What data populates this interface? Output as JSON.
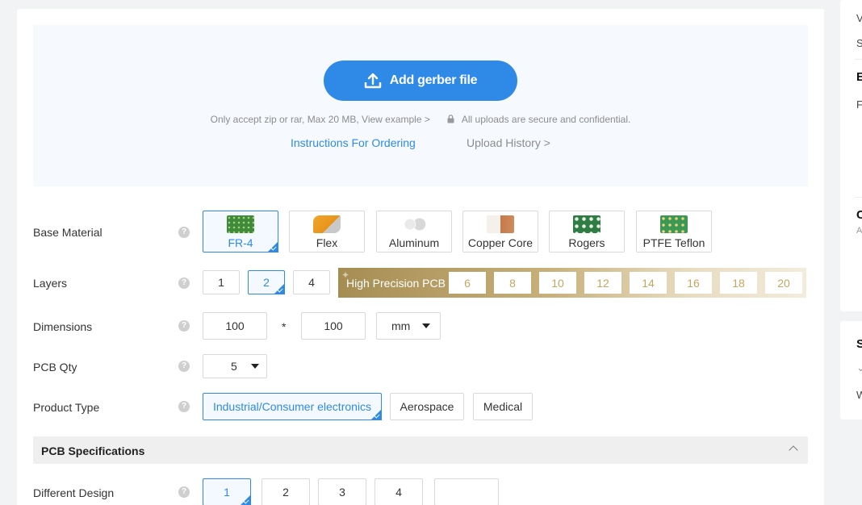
{
  "upload": {
    "button_label": "Add gerber file",
    "note": "Only accept zip or rar, Max 20 MB, View example >",
    "secure_note": "All uploads are secure and confidential.",
    "instructions_link": "Instructions For Ordering",
    "history_link": "Upload History >"
  },
  "base_material": {
    "label": "Base Material",
    "options": [
      "FR-4",
      "Flex",
      "Aluminum",
      "Copper Core",
      "Rogers",
      "PTFE Teflon"
    ],
    "selected": "FR-4"
  },
  "layers": {
    "label": "Layers",
    "options": [
      "1",
      "2",
      "4"
    ],
    "selected": "2",
    "high_precision_label": "High Precision PCB",
    "high_precision_options": [
      "6",
      "8",
      "10",
      "12",
      "14",
      "16",
      "18",
      "20"
    ]
  },
  "dimensions": {
    "label": "Dimensions",
    "width": "100",
    "separator": "*",
    "height": "100",
    "unit": "mm"
  },
  "pcb_qty": {
    "label": "PCB Qty",
    "value": "5"
  },
  "product_type": {
    "label": "Product Type",
    "options": [
      "Industrial/Consumer electronics",
      "Aerospace",
      "Medical"
    ],
    "selected": "Industrial/Consumer electronics"
  },
  "pcb_specifications": {
    "title": "PCB Specifications"
  },
  "different_design": {
    "label": "Different Design",
    "options": [
      "1",
      "2",
      "3",
      "4",
      ""
    ],
    "selected": "1"
  },
  "help_glyph": "?",
  "sidebar_fragments": [
    "V",
    "S",
    "E",
    "F",
    "C",
    "A",
    "S",
    "W"
  ],
  "colors": {
    "accent": "#2f8ae7",
    "gold": "#c2a661",
    "upload_bg": "#f6f9fe"
  }
}
